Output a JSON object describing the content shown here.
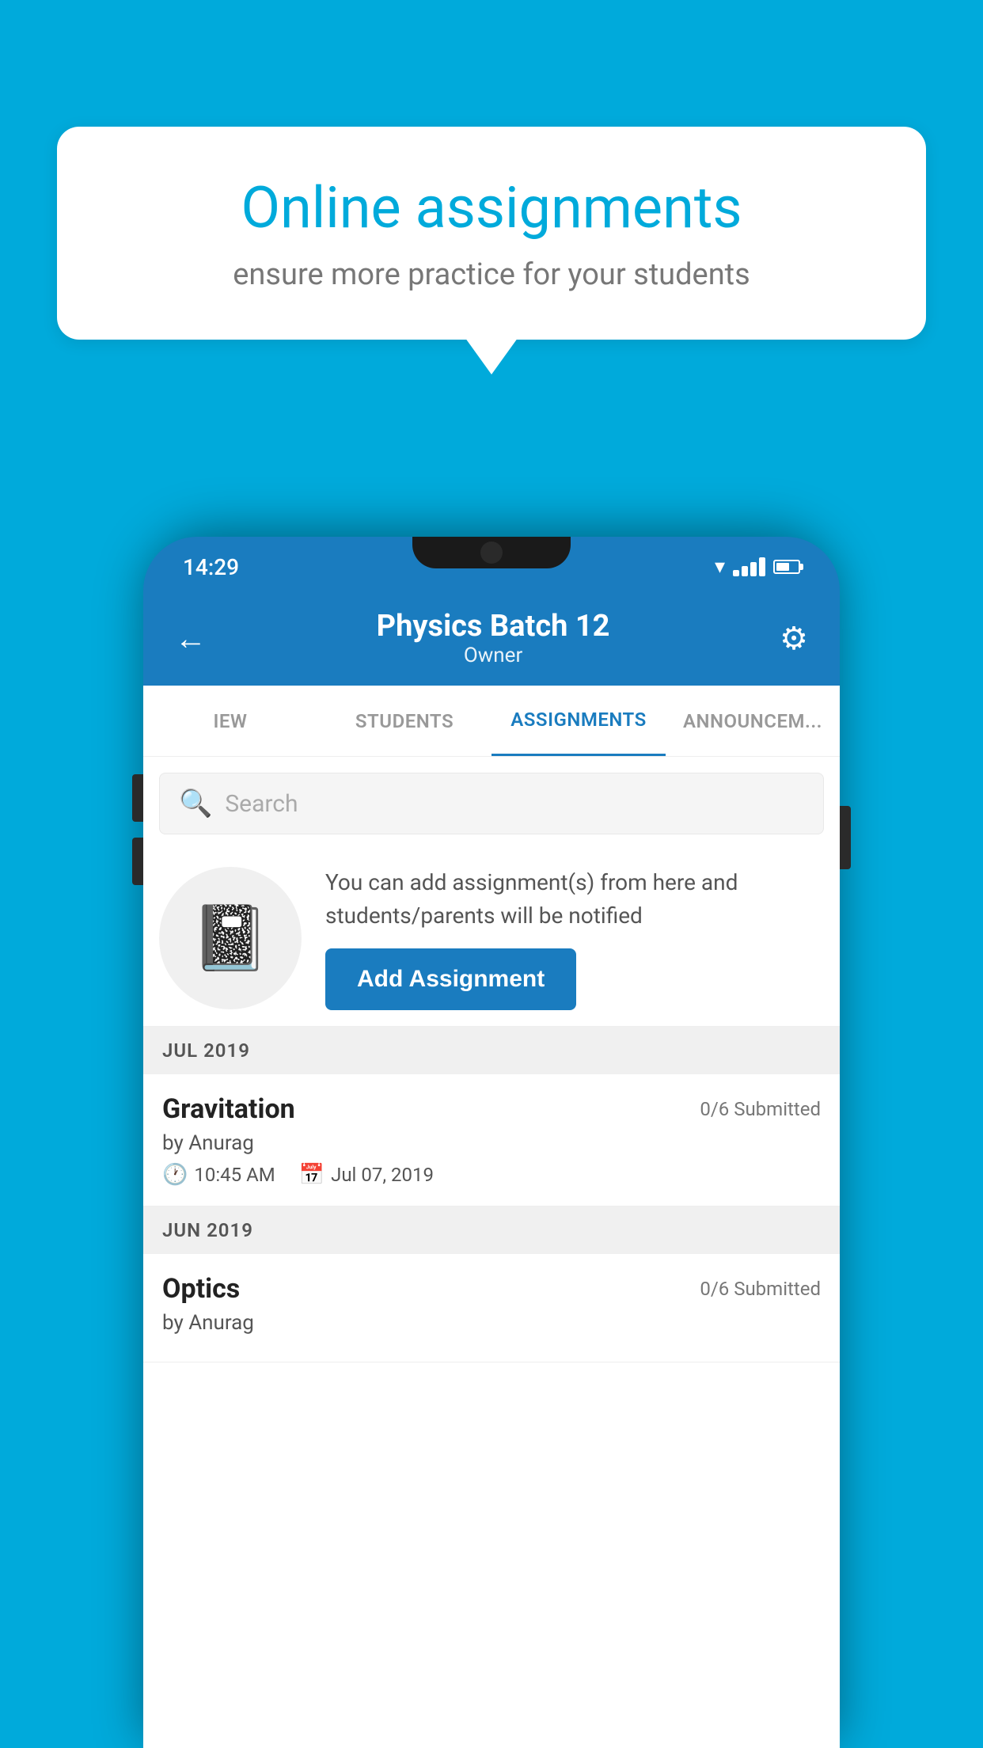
{
  "background": {
    "color": "#00AADB"
  },
  "speech_bubble": {
    "title": "Online assignments",
    "subtitle": "ensure more practice for your students"
  },
  "status_bar": {
    "time": "14:29"
  },
  "app_header": {
    "title": "Physics Batch 12",
    "subtitle": "Owner",
    "back_label": "←",
    "settings_label": "⚙"
  },
  "tabs": [
    {
      "label": "IEW",
      "active": false
    },
    {
      "label": "STUDENTS",
      "active": false
    },
    {
      "label": "ASSIGNMENTS",
      "active": true
    },
    {
      "label": "ANNOUNCEM...",
      "active": false
    }
  ],
  "search": {
    "placeholder": "Search"
  },
  "promo": {
    "description": "You can add assignment(s) from here and students/parents will be notified",
    "add_button_label": "Add Assignment"
  },
  "sections": [
    {
      "month": "JUL 2019",
      "assignments": [
        {
          "title": "Gravitation",
          "submitted": "0/6 Submitted",
          "author": "by Anurag",
          "time": "10:45 AM",
          "date": "Jul 07, 2019"
        }
      ]
    },
    {
      "month": "JUN 2019",
      "assignments": [
        {
          "title": "Optics",
          "submitted": "0/6 Submitted",
          "author": "by Anurag",
          "time": "",
          "date": ""
        }
      ]
    }
  ]
}
